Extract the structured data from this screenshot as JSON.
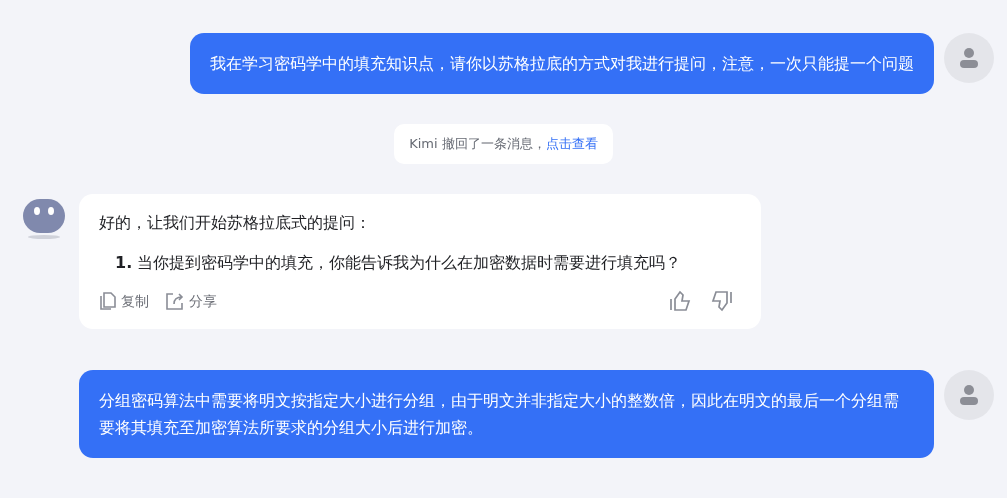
{
  "messages": [
    {
      "kind": "user",
      "text": "我在学习密码学中的填充知识点，请你以苏格拉底的方式对我进行提问，注意，一次只能提一个问题"
    },
    {
      "kind": "notice",
      "text": "Kimi 撤回了一条消息，",
      "link": "点击查看"
    },
    {
      "kind": "assistant",
      "intro": "好的，让我们开始苏格拉底式的提问：",
      "list": [
        {
          "number": "1.",
          "text": "当你提到密码学中的填充，你能告诉我为什么在加密数据时需要进行填充吗？"
        }
      ],
      "actions": [
        {
          "kind": "copy",
          "label": "复制"
        },
        {
          "kind": "share",
          "label": "分享"
        }
      ],
      "feedback": [
        {
          "kind": "like"
        },
        {
          "kind": "dislike"
        }
      ]
    },
    {
      "kind": "user",
      "text": "分组密码算法中需要将明文按指定大小进行分组，由于明文并非指定大小的整数倍，因此在明文的最后一个分组需要将其填充至加密算法所要求的分组大小后进行加密。"
    }
  ]
}
